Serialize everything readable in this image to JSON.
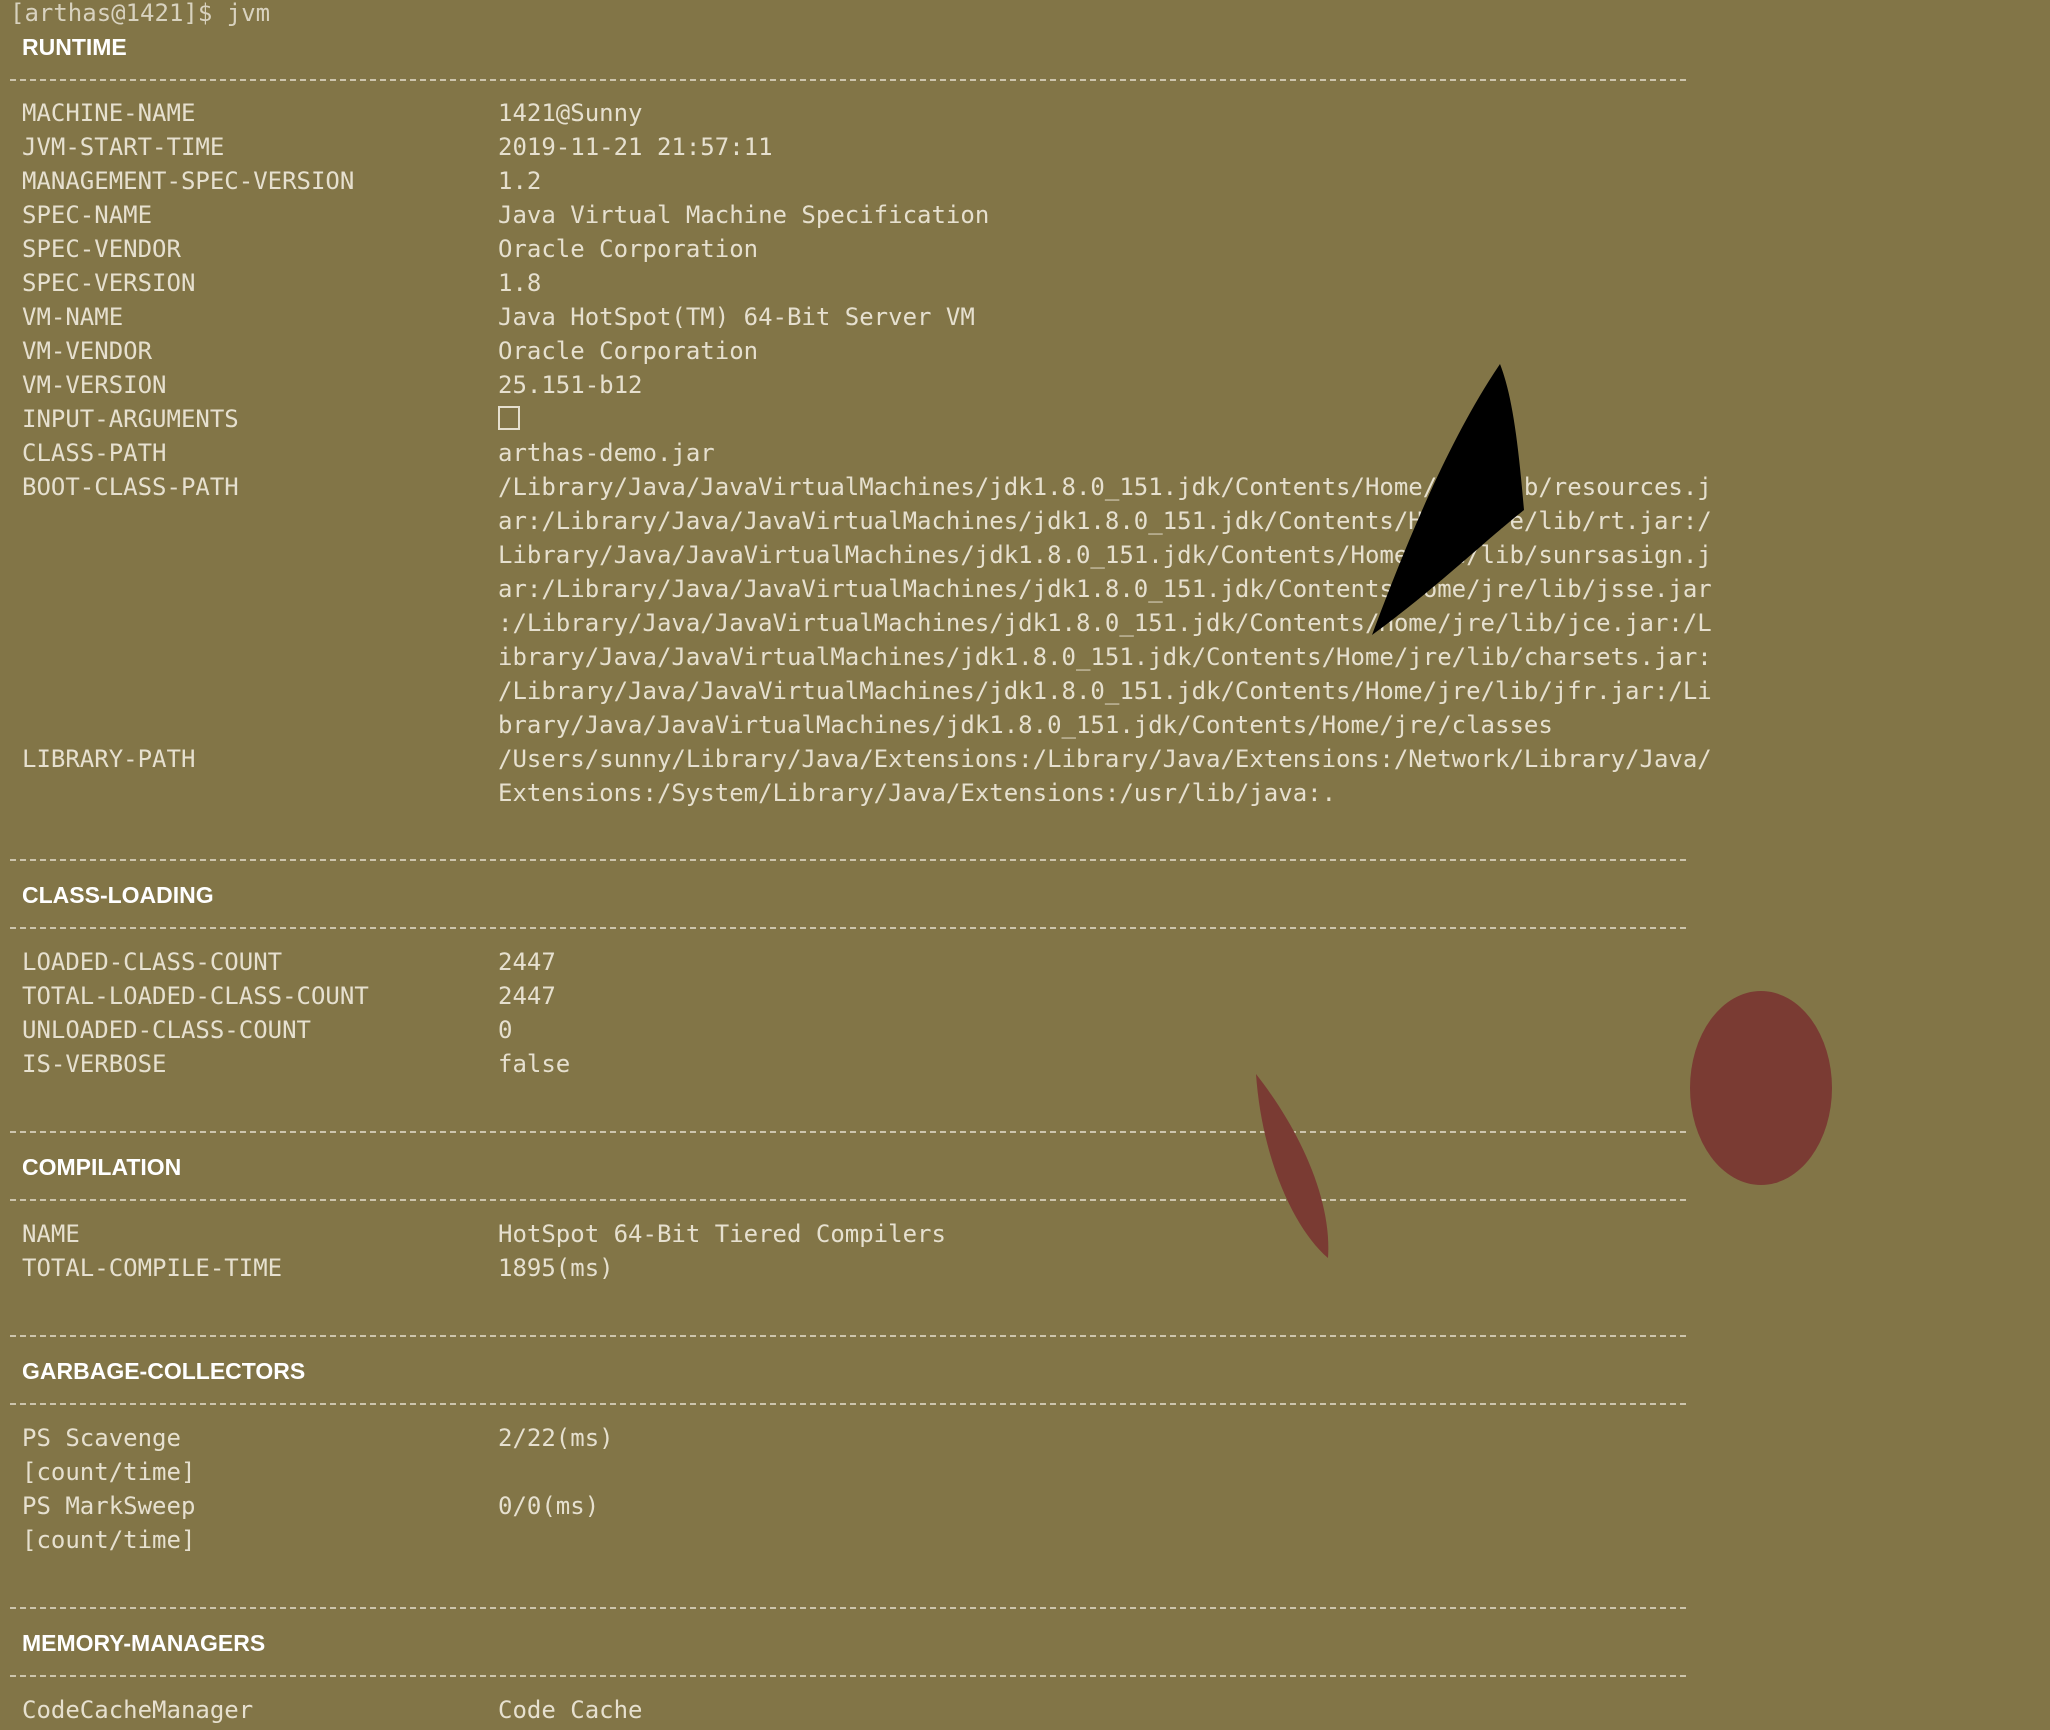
{
  "prompt": "[arthas@1421]$ jvm",
  "sections": {
    "runtime": {
      "title": "RUNTIME",
      "rows": [
        {
          "key": "MACHINE-NAME",
          "value": "1421@Sunny"
        },
        {
          "key": "JVM-START-TIME",
          "value": "2019-11-21 21:57:11"
        },
        {
          "key": "MANAGEMENT-SPEC-VERSION",
          "value": "1.2"
        },
        {
          "key": "SPEC-NAME",
          "value": "Java Virtual Machine Specification"
        },
        {
          "key": "SPEC-VENDOR",
          "value": "Oracle Corporation"
        },
        {
          "key": "SPEC-VERSION",
          "value": "1.8"
        },
        {
          "key": "VM-NAME",
          "value": "Java HotSpot(TM) 64-Bit Server VM"
        },
        {
          "key": "VM-VENDOR",
          "value": "Oracle Corporation"
        },
        {
          "key": "VM-VERSION",
          "value": "25.151-b12"
        },
        {
          "key": "INPUT-ARGUMENTS",
          "value": ""
        },
        {
          "key": "CLASS-PATH",
          "value": "arthas-demo.jar"
        },
        {
          "key": "BOOT-CLASS-PATH",
          "value": "/Library/Java/JavaVirtualMachines/jdk1.8.0_151.jdk/Contents/Home/jre/lib/resources.j"
        }
      ],
      "boot_class_path_cont": [
        "ar:/Library/Java/JavaVirtualMachines/jdk1.8.0_151.jdk/Contents/Home/jre/lib/rt.jar:/",
        "Library/Java/JavaVirtualMachines/jdk1.8.0_151.jdk/Contents/Home/jre/lib/sunrsasign.j",
        "ar:/Library/Java/JavaVirtualMachines/jdk1.8.0_151.jdk/Contents/Home/jre/lib/jsse.jar",
        ":/Library/Java/JavaVirtualMachines/jdk1.8.0_151.jdk/Contents/Home/jre/lib/jce.jar:/L",
        "ibrary/Java/JavaVirtualMachines/jdk1.8.0_151.jdk/Contents/Home/jre/lib/charsets.jar:",
        "/Library/Java/JavaVirtualMachines/jdk1.8.0_151.jdk/Contents/Home/jre/lib/jfr.jar:/Li",
        "brary/Java/JavaVirtualMachines/jdk1.8.0_151.jdk/Contents/Home/jre/classes"
      ],
      "library_path_key": "LIBRARY-PATH",
      "library_path": [
        "/Users/sunny/Library/Java/Extensions:/Library/Java/Extensions:/Network/Library/Java/",
        "Extensions:/System/Library/Java/Extensions:/usr/lib/java:."
      ]
    },
    "class_loading": {
      "title": "CLASS-LOADING",
      "rows": [
        {
          "key": "LOADED-CLASS-COUNT",
          "value": "2447"
        },
        {
          "key": "TOTAL-LOADED-CLASS-COUNT",
          "value": "2447"
        },
        {
          "key": "UNLOADED-CLASS-COUNT",
          "value": "0"
        },
        {
          "key": "IS-VERBOSE",
          "value": "false"
        }
      ]
    },
    "compilation": {
      "title": "COMPILATION",
      "rows": [
        {
          "key": "NAME",
          "value": "HotSpot 64-Bit Tiered Compilers"
        },
        {
          "key": "TOTAL-COMPILE-TIME",
          "value": "1895(ms)"
        }
      ]
    },
    "garbage_collectors": {
      "title": "GARBAGE-COLLECTORS",
      "rows": [
        {
          "key": "PS Scavenge",
          "value": "2/22(ms)",
          "sub": "[count/time]"
        },
        {
          "key": "PS MarkSweep",
          "value": "0/0(ms)",
          "sub": "[count/time]"
        }
      ]
    },
    "memory_managers": {
      "title": "MEMORY-MANAGERS",
      "rows": [
        {
          "key": "CodeCacheManager",
          "value": "Code Cache"
        }
      ]
    }
  },
  "colors": {
    "background": "#827547",
    "text": "#e6e0cf",
    "heading": "#ffffff",
    "overlay_black": "#000000",
    "overlay_red": "#7a3b33"
  }
}
